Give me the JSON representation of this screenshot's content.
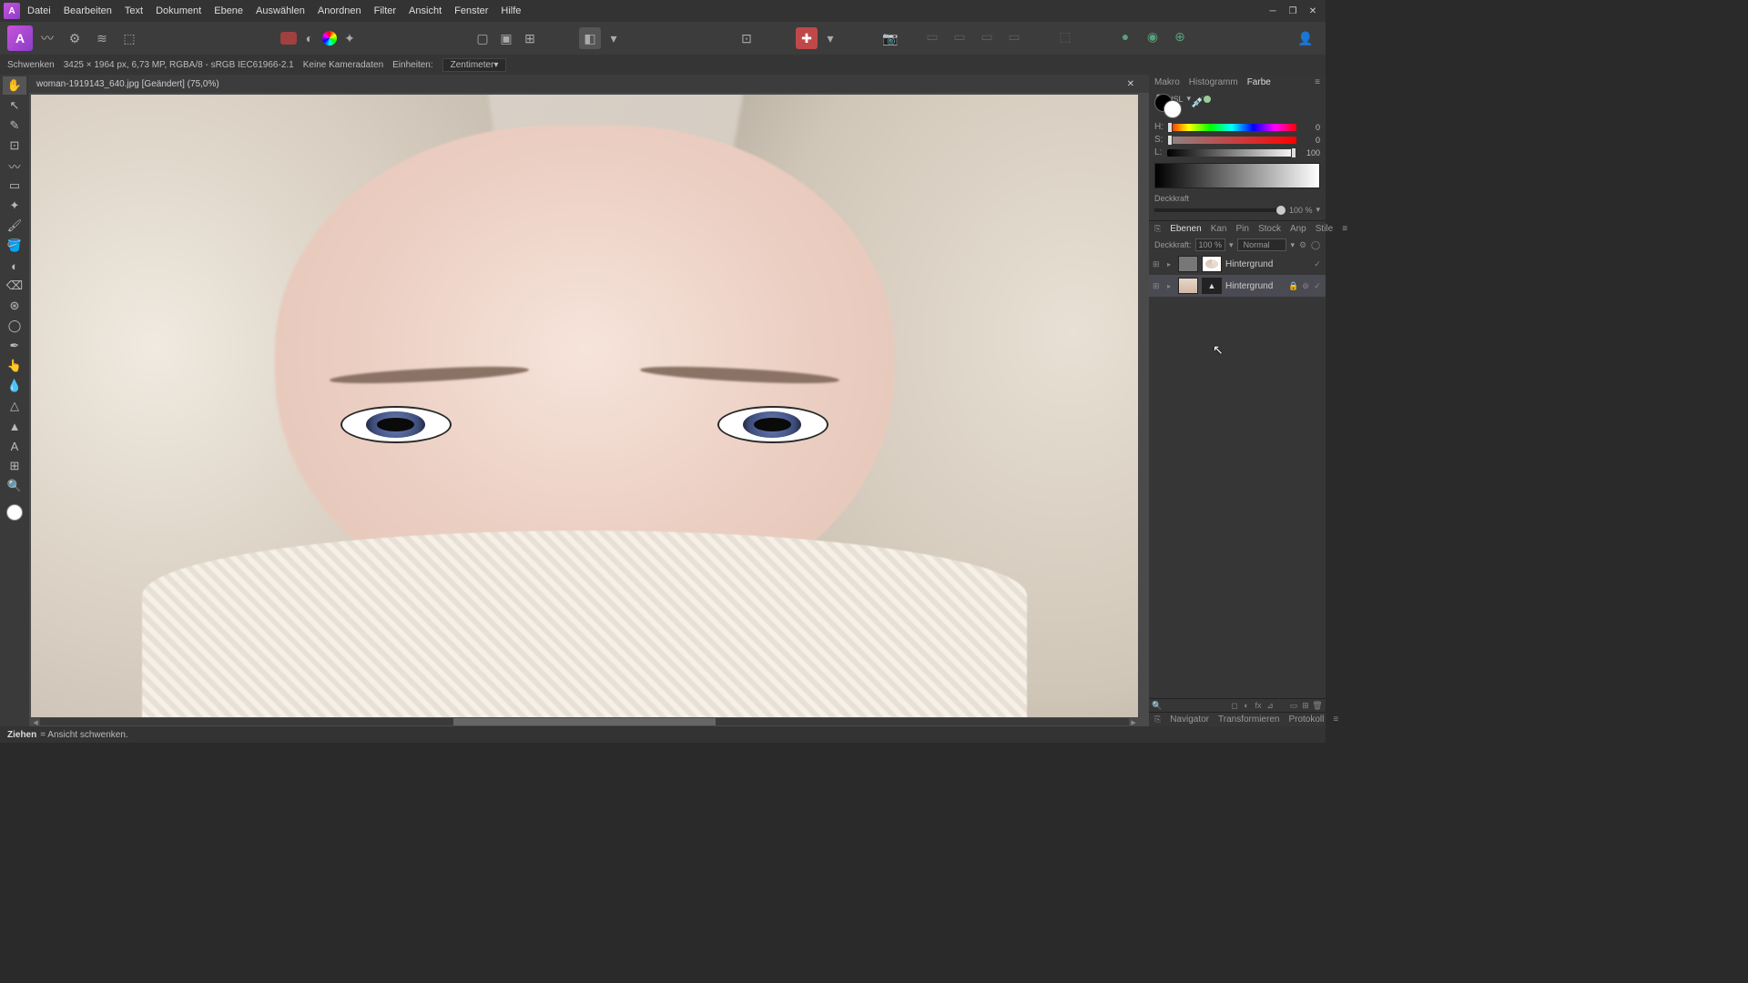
{
  "menu": [
    "Datei",
    "Bearbeiten",
    "Text",
    "Dokument",
    "Ebene",
    "Auswählen",
    "Anordnen",
    "Filter",
    "Ansicht",
    "Fenster",
    "Hilfe"
  ],
  "optionsbar": {
    "tool": "Schwenken",
    "docinfo": "3425 × 1964 px, 6,73 MP, RGBA/8 - sRGB IEC61966-2.1",
    "camera": "Keine Kameradaten",
    "units_label": "Einheiten:",
    "units_value": "Zentimeter"
  },
  "doc": {
    "title": "woman-1919143_640.jpg [Geändert] (75,0%)"
  },
  "right_tabs_top": [
    "Makro",
    "Histogramm",
    "Farbe"
  ],
  "color": {
    "mode": "HSL",
    "h_label": "H:",
    "s_label": "S:",
    "l_label": "L:",
    "h": "0",
    "s": "0",
    "l": "100",
    "opacity_label": "Deckkraft",
    "opacity_value": "100 %"
  },
  "layer_tabs": [
    "Ebenen",
    "Kan",
    "Pin",
    "Stock",
    "Anp",
    "Stile"
  ],
  "layers": {
    "opacity_label": "Deckkraft:",
    "opacity_value": "100 %",
    "blend": "Normal",
    "items": [
      {
        "name": "Hintergrund",
        "selected": false
      },
      {
        "name": "Hintergrund",
        "selected": true
      }
    ]
  },
  "bottom_tabs": [
    "Navigator",
    "Transformieren",
    "Protokoll"
  ],
  "status": {
    "label": "Ziehen",
    "text": "= Ansicht schwenken."
  }
}
